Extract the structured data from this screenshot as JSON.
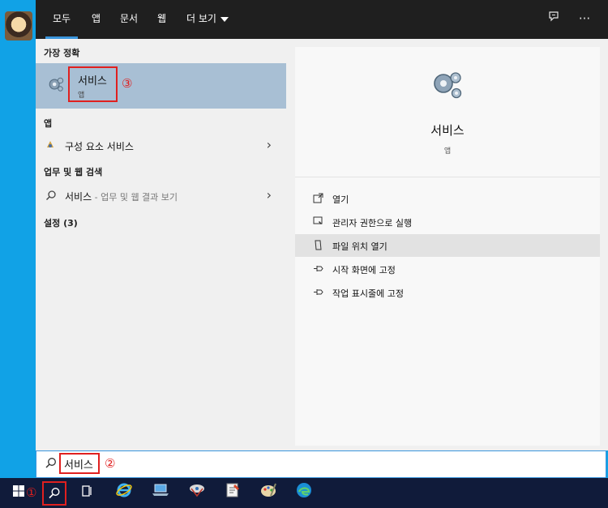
{
  "tabs": [
    {
      "label": "모두"
    },
    {
      "label": "앱"
    },
    {
      "label": "문서"
    },
    {
      "label": "웹"
    },
    {
      "label": "더 보기"
    }
  ],
  "topbar_icons": {
    "feedback": "feedback-icon",
    "more": "···"
  },
  "left": {
    "best_match_title": "가장 정확",
    "best_match": {
      "title": "서비스",
      "subtitle": "앱",
      "annotation": "③"
    },
    "apps_title": "앱",
    "apps_item": {
      "label": "구성 요소 서비스"
    },
    "web_title": "업무 및 웹 검색",
    "web_item": {
      "label": "서비스",
      "suffix": " - 업무 및 웹 결과 보기"
    },
    "settings_title": "설정 (3)"
  },
  "detail": {
    "name": "서비스",
    "type": "앱",
    "actions": [
      {
        "label": "열기",
        "icon": "open-icon"
      },
      {
        "label": "관리자 권한으로 실행",
        "icon": "run-as-admin-icon"
      },
      {
        "label": "파일 위치 열기",
        "icon": "file-location-icon"
      },
      {
        "label": "시작 화면에 고정",
        "icon": "pin-icon"
      },
      {
        "label": "작업 표시줄에 고정",
        "icon": "pin-icon"
      }
    ]
  },
  "search": {
    "value": "서비스",
    "annotation": "②"
  },
  "taskbar": {
    "start_annotation": "①"
  },
  "colors": {
    "accent": "#3a96dd",
    "highlight": "#a8bfd4",
    "annotation": "#e0201f",
    "taskbar": "#101b3a"
  }
}
